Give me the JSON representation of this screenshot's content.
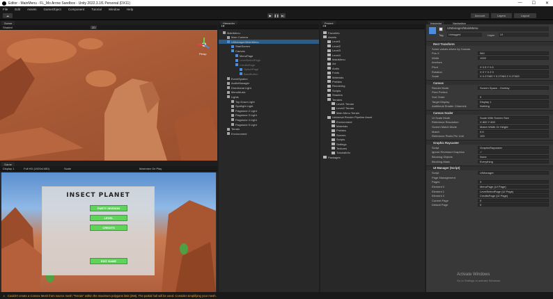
{
  "window": {
    "title": "Editor - MainMenu - FL_Mo Arrow Sandbox - Unity 2022.3.1f1 Personal (DX11)",
    "minimize": "—",
    "maximize": "☐",
    "close": "✕"
  },
  "menu": [
    "File",
    "Edit",
    "Assets",
    "GameObject",
    "Component",
    "Tutorial",
    "Window",
    "Help"
  ],
  "toolbar": {
    "layers": "Layers",
    "layout": "Layout",
    "account": "Account"
  },
  "scene": {
    "tab": "Scene",
    "persp": "Persp",
    "mode_label": "Shaded",
    "view2d": "2D"
  },
  "game": {
    "tab": "Game",
    "display": "Display 1",
    "resolution": "Full HD (1920x1080)",
    "scale": "Scale",
    "maximize": "Maximize On Play",
    "title": "INSECT PLANET",
    "buttons": [
      "PARTY SESSION",
      "LEVEL",
      "CREDITS",
      "EXIT GAME"
    ]
  },
  "hierarchy": {
    "tab": "Hierarchy",
    "items": [
      {
        "label": "MainMenu",
        "depth": 0,
        "kind": "scene"
      },
      {
        "label": "Main Camera",
        "depth": 1,
        "kind": "obj"
      },
      {
        "label": "UIManager/MainMenu",
        "depth": 1,
        "kind": "ui",
        "selected": true
      },
      {
        "label": "StartScreen",
        "depth": 2,
        "kind": "ui"
      },
      {
        "label": "Canvas",
        "depth": 2,
        "kind": "ui"
      },
      {
        "label": "MenuPage",
        "depth": 3,
        "kind": "ui"
      },
      {
        "label": "LevelSelectPage",
        "depth": 3,
        "kind": "ui-dim"
      },
      {
        "label": "CreditsPage",
        "depth": 3,
        "kind": "ui-dim"
      },
      {
        "label": "OptionPage",
        "depth": 4,
        "kind": "ui-dim"
      },
      {
        "label": "BackButton",
        "depth": 4,
        "kind": "ui-dim"
      },
      {
        "label": "EventSystem",
        "depth": 1,
        "kind": "obj"
      },
      {
        "label": "AudioManager",
        "depth": 1,
        "kind": "obj"
      },
      {
        "label": "Directional Light",
        "depth": 1,
        "kind": "obj"
      },
      {
        "label": "MenuMusic",
        "depth": 1,
        "kind": "obj"
      },
      {
        "label": "Lights",
        "depth": 1,
        "kind": "obj"
      },
      {
        "label": "Top Down Light",
        "depth": 2,
        "kind": "obj"
      },
      {
        "label": "Spotlight Light",
        "depth": 2,
        "kind": "obj"
      },
      {
        "label": "Flagstone 2 Light",
        "depth": 2,
        "kind": "obj"
      },
      {
        "label": "Flagstone 3 Light",
        "depth": 2,
        "kind": "obj"
      },
      {
        "label": "Flagstone 4 Light",
        "depth": 2,
        "kind": "obj"
      },
      {
        "label": "Flagstone 5 Light",
        "depth": 2,
        "kind": "obj"
      },
      {
        "label": "Terrain",
        "depth": 1,
        "kind": "obj"
      },
      {
        "label": "Environment",
        "depth": 1,
        "kind": "obj"
      }
    ]
  },
  "project": {
    "tab": "Project",
    "items": [
      {
        "label": "Favorites",
        "depth": 0
      },
      {
        "label": "Assets",
        "depth": 0
      },
      {
        "label": "Level1",
        "depth": 1
      },
      {
        "label": "Level2",
        "depth": 1
      },
      {
        "label": "Level3",
        "depth": 1
      },
      {
        "label": "Level4",
        "depth": 1
      },
      {
        "label": "MainMenu",
        "depth": 1
      },
      {
        "label": "Art",
        "depth": 1
      },
      {
        "label": "Audio",
        "depth": 1
      },
      {
        "label": "Fonts",
        "depth": 1
      },
      {
        "label": "Materials",
        "depth": 1
      },
      {
        "label": "Prefabs",
        "depth": 1
      },
      {
        "label": "Rendering",
        "depth": 1
      },
      {
        "label": "Scripts",
        "depth": 1
      },
      {
        "label": "Shaders",
        "depth": 1
      },
      {
        "label": "Terrains",
        "depth": 1
      },
      {
        "label": "Level1 Terrain",
        "depth": 2
      },
      {
        "label": "Level2 Terrain",
        "depth": 2
      },
      {
        "label": "Main Menu Terrain",
        "depth": 2
      },
      {
        "label": "Universal Render Pipeline Asset",
        "depth": 1
      },
      {
        "label": "Environment",
        "depth": 2
      },
      {
        "label": "Materials",
        "depth": 2
      },
      {
        "label": "Prefabs",
        "depth": 2
      },
      {
        "label": "Scenes",
        "depth": 2
      },
      {
        "label": "Scripts",
        "depth": 2
      },
      {
        "label": "Settings",
        "depth": 2
      },
      {
        "label": "Textures",
        "depth": 2
      },
      {
        "label": "TutorialInfo",
        "depth": 2
      },
      {
        "label": "Packages",
        "depth": 0
      }
    ]
  },
  "inspector": {
    "tab": "Inspector",
    "tab2": "Navigation",
    "object_name": "UIManager/MainMenu",
    "tag_label": "Tag",
    "tag_value": "Untagged",
    "layer_label": "Layer",
    "layer_value": "UI",
    "sections": [
      {
        "title": "Rect Transform",
        "rows": [
          {
            "label": "Some values driven by Canvas.",
            "value": ""
          },
          {
            "label": "Pos X",
            "value": "960"
          },
          {
            "label": "Width",
            "value": "1920"
          },
          {
            "label": "Anchors",
            "value": ""
          },
          {
            "label": "Pivot",
            "value": "X 0.5    Y 0.5"
          },
          {
            "label": "Rotation",
            "value": "X 0    Y 0    Z 0"
          },
          {
            "label": "Scale",
            "value": "X 0.27083  Y 0.27083  Z 0.27083"
          }
        ]
      },
      {
        "title": "Canvas",
        "rows": [
          {
            "label": "Render Mode",
            "value": "Screen Space - Overlay"
          },
          {
            "label": "Pixel Perfect",
            "value": ""
          },
          {
            "label": "Sort Order",
            "value": "0"
          },
          {
            "label": "Target Display",
            "value": "Display 1"
          },
          {
            "label": "Additional Shader Channels",
            "value": "Nothing"
          }
        ]
      },
      {
        "title": "Canvas Scaler",
        "rows": [
          {
            "label": "UI Scale Mode",
            "value": "Scale With Screen Size"
          },
          {
            "label": "Reference Resolution",
            "value": "X 800    Y 600"
          },
          {
            "label": "Screen Match Mode",
            "value": "Match Width Or Height"
          },
          {
            "label": "Match",
            "value": "0.5"
          },
          {
            "label": "Reference Pixels Per Unit",
            "value": "100"
          }
        ]
      },
      {
        "title": "Graphic Raycaster",
        "rows": [
          {
            "label": "Script",
            "value": "GraphicRaycaster"
          },
          {
            "label": "Ignore Reversed Graphics",
            "value": "✓"
          },
          {
            "label": "Blocking Objects",
            "value": "None"
          },
          {
            "label": "Blocking Mask",
            "value": "Everything"
          }
        ]
      },
      {
        "title": "UI Manager (Script)",
        "rows": [
          {
            "label": "Script",
            "value": "UIManager"
          },
          {
            "label": "Page Management",
            "value": ""
          },
          {
            "label": "Pages",
            "value": "3"
          },
          {
            "label": "Element 0",
            "value": "MenuPage (UI Page)"
          },
          {
            "label": "Element 1",
            "value": "LevelSelectPage (UI Page)"
          },
          {
            "label": "Element 2",
            "value": "CreditsPage (UI Page)"
          },
          {
            "label": "Current Page",
            "value": "0"
          },
          {
            "label": "Default Page",
            "value": "0"
          }
        ]
      }
    ]
  },
  "watermark": {
    "line1": "Activate Windows",
    "line2": "Go to Settings to activate Windows."
  },
  "status": "Couldn't create a Convex Mesh from source mesh \"Terrain\" within the maximum polygons limit (256). The partial hull will be used. Consider simplifying your mesh."
}
